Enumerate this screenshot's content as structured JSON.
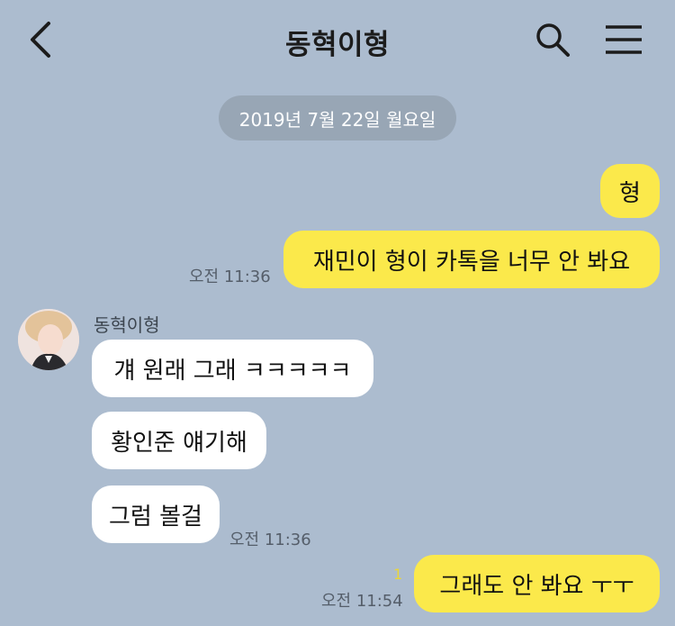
{
  "header": {
    "title": "동혁이형",
    "back_icon": "chevron-left-icon",
    "search_icon": "search-icon",
    "menu_icon": "hamburger-menu-icon"
  },
  "date_divider": "2019년 7월 22일 월요일",
  "messages": {
    "m1": {
      "text": "형"
    },
    "m2": {
      "text": "재민이 형이 카톡을 너무 안 봐요",
      "time": "오전 11:36"
    },
    "sender_name": "동혁이형",
    "m3": {
      "text": "걔 원래 그래 ㅋㅋㅋㅋㅋ"
    },
    "m4": {
      "text": "황인준 얘기해"
    },
    "m5": {
      "text": "그럼 볼걸",
      "time": "오전 11:36"
    },
    "m6": {
      "text": "그래도 안 봐요 ㅜㅜ",
      "time": "오전 11:54",
      "unread": "1"
    }
  },
  "colors": {
    "background": "#acbccf",
    "my_bubble": "#fbe94b",
    "their_bubble": "#ffffff",
    "date_pill": "#98a6b5"
  }
}
